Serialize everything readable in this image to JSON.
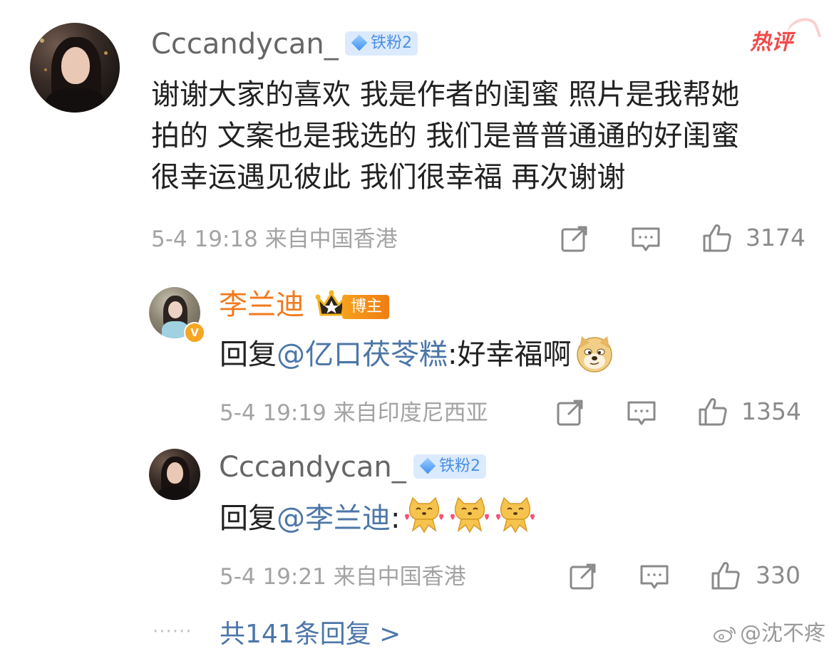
{
  "comment": {
    "username": "Cccandycan_",
    "fan_badge": "铁粉2",
    "hot_label": "热评",
    "lines": [
      "谢谢大家的喜欢 我是作者的闺蜜 照片是我帮她",
      "拍的 文案也是我选的 我们是普普通通的好闺蜜",
      "很幸运遇见彼此 我们很幸福  再次谢谢"
    ],
    "meta": "5-4 19:18  来自中国香港",
    "likes": "3174"
  },
  "replies": [
    {
      "username": "李兰迪",
      "badge": "博主",
      "verified_mark": "V",
      "prefix": "回复",
      "mention": "@亿口茯苓糕",
      "text": ":好幸福啊",
      "emoji": "doge-emoji",
      "meta": "5-4 19:19  来自印度尼西亚",
      "likes": "1354"
    },
    {
      "username": "Cccandycan_",
      "fan_badge": "铁粉2",
      "prefix": "回复",
      "mention": "@李兰迪",
      "text": ":",
      "emoji": "cat-love-emoji",
      "meta": "5-4 19:21  来自中国香港",
      "likes": "330"
    }
  ],
  "footer": {
    "dots": "······",
    "more_replies": "共141条回复 >",
    "watermark": "@沈不疼"
  },
  "icons": {
    "share": "share-icon",
    "comment": "comment-icon",
    "like": "thumbs-up-icon",
    "weibo": "weibo-logo-icon"
  },
  "colors": {
    "username_gray": "#666666",
    "blogger_orange": "#f17a1c",
    "mention_blue": "#4c76a8",
    "hot_red": "#ef4b4b",
    "fan_badge_bg": "#dceafd"
  }
}
